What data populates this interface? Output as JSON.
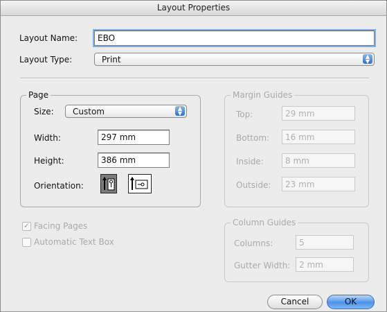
{
  "window": {
    "title": "Layout Properties"
  },
  "layout": {
    "name_label": "Layout Name:",
    "name_value": "EBO",
    "type_label": "Layout Type:",
    "type_value": "Print"
  },
  "page": {
    "group_title": "Page",
    "size_label": "Size:",
    "size_value": "Custom",
    "width_label": "Width:",
    "width_value": "297 mm",
    "height_label": "Height:",
    "height_value": "386 mm",
    "orientation_label": "Orientation:",
    "orientation_selected": "portrait"
  },
  "margin_guides": {
    "group_title": "Margin Guides",
    "top_label": "Top:",
    "top_value": "29 mm",
    "bottom_label": "Bottom:",
    "bottom_value": "16 mm",
    "inside_label": "Inside:",
    "inside_value": "8 mm",
    "outside_label": "Outside:",
    "outside_value": "23 mm"
  },
  "options": {
    "facing_pages_label": "Facing Pages",
    "facing_pages_checked": true,
    "auto_text_box_label": "Automatic Text Box",
    "auto_text_box_checked": false
  },
  "column_guides": {
    "group_title": "Column Guides",
    "columns_label": "Columns:",
    "columns_value": "5",
    "gutter_label": "Gutter Width:",
    "gutter_value": "2 mm"
  },
  "buttons": {
    "cancel": "Cancel",
    "ok": "OK"
  },
  "colors": {
    "accent": "#4f92e8",
    "window_bg": "#ececec",
    "disabled_text": "#a9a9a9"
  }
}
